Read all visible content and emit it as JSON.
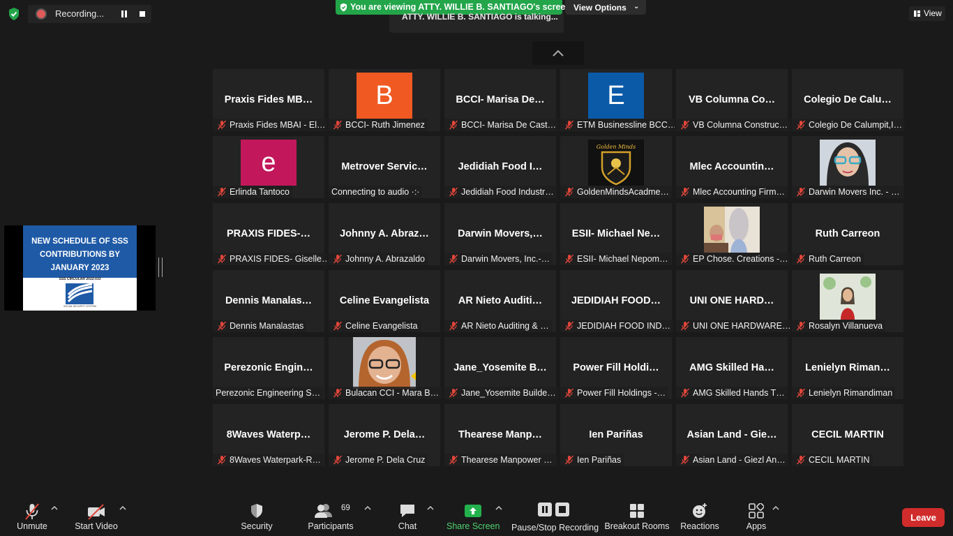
{
  "top": {
    "recording_label": "Recording...",
    "viewing_banner": "You are viewing ATTY. WILLIE B. SANTIAGO's screen",
    "view_options_label": "View Options",
    "talking_text": "ATTY. WILLIE B. SANTIAGO is talking...",
    "view_label": "View"
  },
  "shared_slide": {
    "title_line1": "NEW SCHEDULE OF SSS",
    "title_line2": "CONTRIBUTIONS BY",
    "title_line3": "JANUARY 2023",
    "subtitle": "SSS CIRCULAR 2022-033",
    "footer": "SOCIAL SECURITY SYSTEM"
  },
  "tiles": [
    {
      "name": "Praxis Fides MB…",
      "label": "Praxis Fides MBAI - El…",
      "muted": true
    },
    {
      "name": "",
      "label": "BCCI- Ruth Jimenez",
      "muted": true,
      "avatar": "B",
      "avatar_color": "#f05a22"
    },
    {
      "name": "BCCI- Marisa De…",
      "label": "BCCI- Marisa De Cast…",
      "muted": true
    },
    {
      "name": "",
      "label": "ETM Businessline BCC…",
      "muted": true,
      "avatar": "E",
      "avatar_color": "#0b5aa8"
    },
    {
      "name": "VB Columna Co…",
      "label": "VB Columna Construc…",
      "muted": true
    },
    {
      "name": "Colegio De Calu…",
      "label": "Colegio De Calumpit,I…",
      "muted": true
    },
    {
      "name": "",
      "label": "Erlinda Tantoco",
      "muted": true,
      "avatar": "e",
      "avatar_color": "#c2185b"
    },
    {
      "name": "Metrover Servic…",
      "label": "Connecting to audio ·:·",
      "muted": false
    },
    {
      "name": "Jedidiah Food I…",
      "label": "Jedidiah Food Industr…",
      "muted": true
    },
    {
      "name": "",
      "label": "GoldenMindsAcadme…",
      "muted": true,
      "photo": "golden"
    },
    {
      "name": "Mlec Accountin…",
      "label": "Mlec Accounting Firm…",
      "muted": true
    },
    {
      "name": "",
      "label": "Darwin Movers Inc. - …",
      "muted": true,
      "photo": "woman"
    },
    {
      "name": "PRAXIS FIDES-…",
      "label": "PRAXIS FIDES- Giselle…",
      "muted": true
    },
    {
      "name": "Johnny A. Abraz…",
      "label": "Johnny A. Abrazaldo",
      "muted": true
    },
    {
      "name": "Darwin Movers,…",
      "label": "Darwin Movers, Inc.-…",
      "muted": true
    },
    {
      "name": "ESII- Michael Ne…",
      "label": "ESII- Michael Nepom…",
      "muted": true
    },
    {
      "name": "",
      "label": "EP Chose. Creations -…",
      "muted": true,
      "photo": "religious"
    },
    {
      "name": "Ruth Carreon",
      "label": "Ruth Carreon",
      "muted": true
    },
    {
      "name": "Dennis Manalas…",
      "label": "Dennis Manalastas",
      "muted": true
    },
    {
      "name": "Celine Evangelista",
      "label": "Celine Evangelista",
      "muted": true
    },
    {
      "name": "AR Nieto Auditi…",
      "label": "AR Nieto Auditing & …",
      "muted": true
    },
    {
      "name": "JEDIDIAH FOOD…",
      "label": "JEDIDIAH FOOD IND…",
      "muted": true
    },
    {
      "name": "UNI ONE HARD…",
      "label": "UNI ONE HARDWARE…",
      "muted": true
    },
    {
      "name": "",
      "label": "Rosalyn Villanueva",
      "muted": true,
      "photo": "woman2"
    },
    {
      "name": "Perezonic Engin…",
      "label": "Perezonic Engineering S…",
      "muted": false
    },
    {
      "name": "",
      "label": "Bulacan CCI - Mara B…",
      "muted": true,
      "photo": "face"
    },
    {
      "name": "Jane_Yosemite B…",
      "label": "Jane_Yosemite Builde…",
      "muted": true
    },
    {
      "name": "Power Fill Holdi…",
      "label": "Power Fill Holdings -…",
      "muted": true
    },
    {
      "name": "AMG Skilled Ha…",
      "label": "AMG Skilled Hands T…",
      "muted": true
    },
    {
      "name": "Lenielyn Riman…",
      "label": "Lenielyn Rimandiman",
      "muted": true
    },
    {
      "name": "8Waves Waterp…",
      "label": "8Waves Waterpark-R…",
      "muted": true
    },
    {
      "name": "Jerome P. Dela…",
      "label": "Jerome P. Dela Cruz",
      "muted": true
    },
    {
      "name": "Thearese Manp…",
      "label": "Thearese Manpower …",
      "muted": true
    },
    {
      "name": "Ien Pariñas",
      "label": "Ien Pariñas",
      "muted": true
    },
    {
      "name": "Asian Land - Gie…",
      "label": "Asian Land - Giezl An…",
      "muted": true
    },
    {
      "name": "CECIL MARTIN",
      "label": "CECIL MARTIN",
      "muted": true
    }
  ],
  "toolbar": {
    "unmute": "Unmute",
    "start_video": "Start Video",
    "security": "Security",
    "participants": "Participants",
    "participants_count": "69",
    "chat": "Chat",
    "share_screen": "Share Screen",
    "pause_stop_recording": "Pause/Stop Recording",
    "breakout_rooms": "Breakout Rooms",
    "reactions": "Reactions",
    "apps": "Apps",
    "leave": "Leave"
  },
  "colors": {
    "background": "#1a1a1a",
    "tile": "#232323",
    "banner_green": "#23a54a",
    "leave_red": "#d12c2c",
    "muted_red": "#e0463a"
  }
}
